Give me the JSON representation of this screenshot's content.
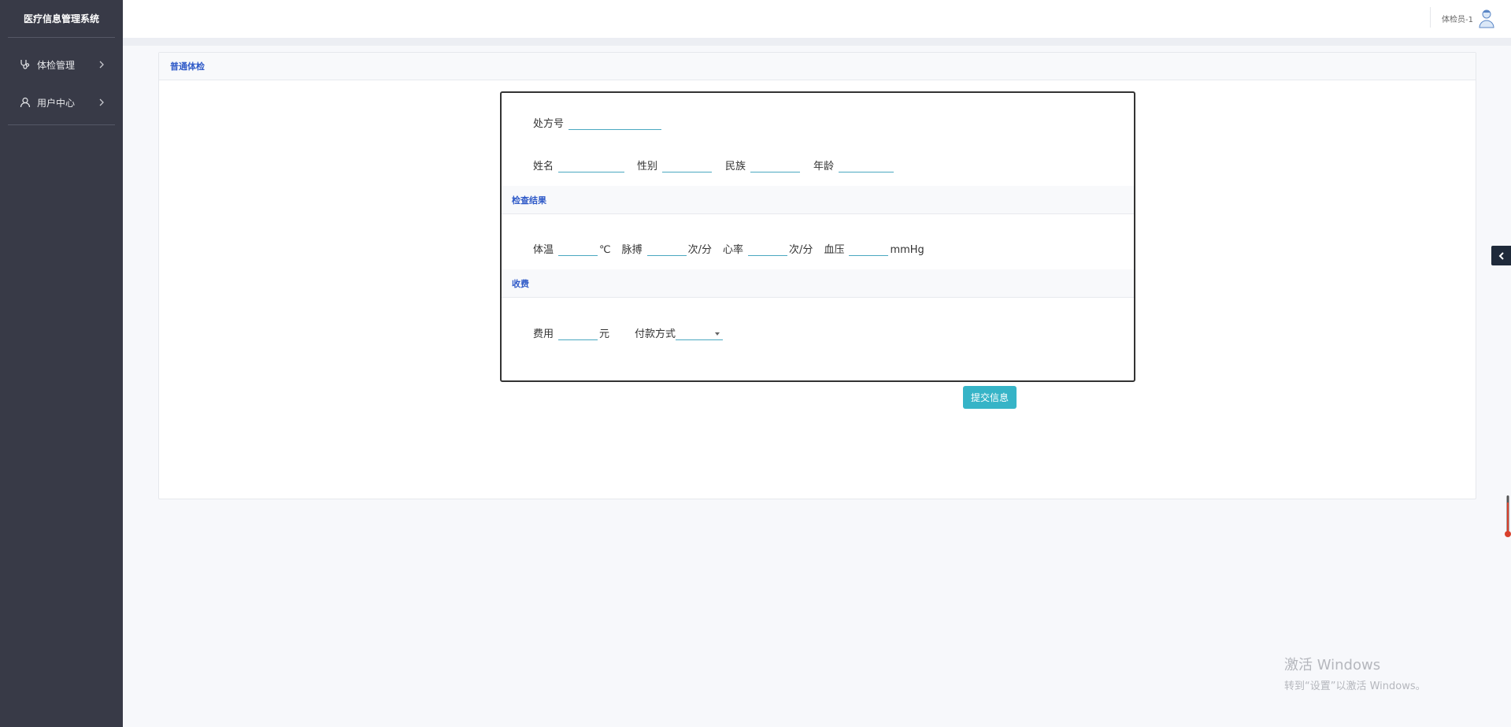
{
  "app": {
    "title": "医疗信息管理系统"
  },
  "sidebar": {
    "items": [
      {
        "label": "体检管理",
        "icon": "stethoscope-icon"
      },
      {
        "label": "用户中心",
        "icon": "user-icon"
      }
    ]
  },
  "header": {
    "user_name": "体检员-1"
  },
  "card": {
    "title": "普通体检"
  },
  "form": {
    "prescription_label": "处方号",
    "name_label": "姓名",
    "gender_label": "性别",
    "ethnicity_label": "民族",
    "age_label": "年龄",
    "section_results": "检查结果",
    "temp_label": "体温",
    "temp_unit": "℃",
    "pulse_label": "脉搏",
    "pulse_unit": "次/分",
    "heart_label": "心率",
    "heart_unit": "次/分",
    "bp_label": "血压",
    "bp_unit": "mmHg",
    "section_fee": "收费",
    "fee_label": "费用",
    "fee_unit": "元",
    "payment_label": "付款方式",
    "payment_value": ""
  },
  "actions": {
    "submit_label": "提交信息"
  },
  "watermark": {
    "line1": "激活 Windows",
    "line2": "转到“设置”以激活 Windows。"
  },
  "colors": {
    "sidebar": "#383a47",
    "accent": "#36b4c7",
    "link": "#2f5ac8"
  }
}
